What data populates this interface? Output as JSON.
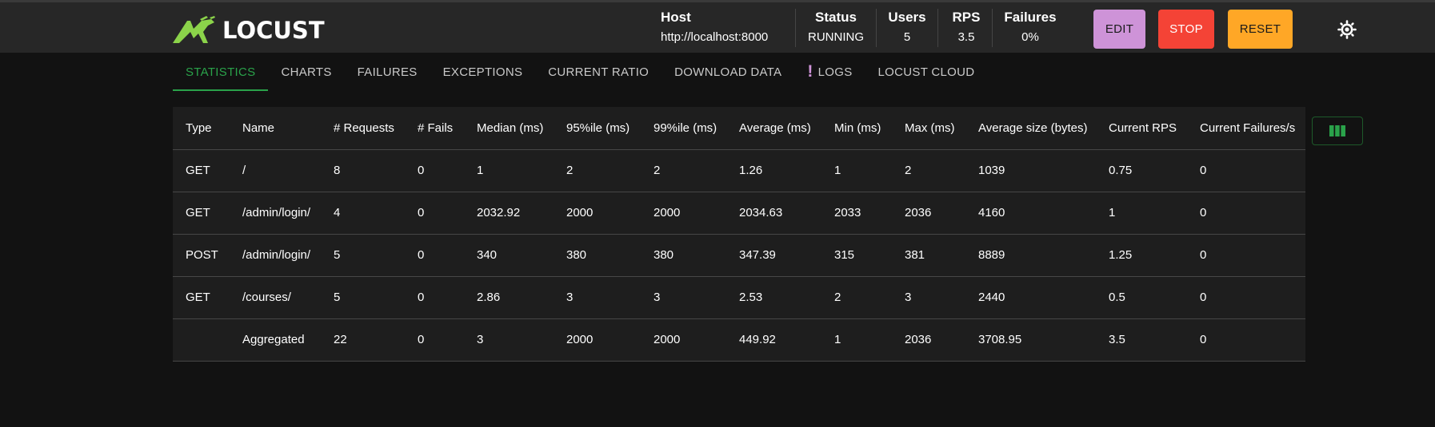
{
  "app": {
    "name": "LOCUST",
    "brand_color": "#8bd34a"
  },
  "header": {
    "host": {
      "label": "Host",
      "value": "http://localhost:8000"
    },
    "status": {
      "label": "Status",
      "value": "RUNNING"
    },
    "users": {
      "label": "Users",
      "value": "5"
    },
    "rps": {
      "label": "RPS",
      "value": "3.5"
    },
    "failures": {
      "label": "Failures",
      "value": "0%"
    },
    "buttons": {
      "edit": "EDIT",
      "stop": "STOP",
      "reset": "RESET"
    },
    "theme_icon": "sun-icon"
  },
  "tabs": [
    {
      "label": "STATISTICS",
      "active": true
    },
    {
      "label": "CHARTS"
    },
    {
      "label": "FAILURES"
    },
    {
      "label": "EXCEPTIONS"
    },
    {
      "label": "CURRENT RATIO"
    },
    {
      "label": "DOWNLOAD DATA"
    },
    {
      "label": "LOGS",
      "icon": "exclamation-icon"
    },
    {
      "label": "LOCUST CLOUD"
    }
  ],
  "table": {
    "columns": [
      "Type",
      "Name",
      "# Requests",
      "# Fails",
      "Median (ms)",
      "95%ile (ms)",
      "99%ile (ms)",
      "Average (ms)",
      "Min (ms)",
      "Max (ms)",
      "Average size (bytes)",
      "Current RPS",
      "Current Failures/s"
    ],
    "rows": [
      [
        "GET",
        "/",
        "8",
        "0",
        "1",
        "2",
        "2",
        "1.26",
        "1",
        "2",
        "1039",
        "0.75",
        "0"
      ],
      [
        "GET",
        "/admin/login/",
        "4",
        "0",
        "2032.92",
        "2000",
        "2000",
        "2034.63",
        "2033",
        "2036",
        "4160",
        "1",
        "0"
      ],
      [
        "POST",
        "/admin/login/",
        "5",
        "0",
        "340",
        "380",
        "380",
        "347.39",
        "315",
        "381",
        "8889",
        "1.25",
        "0"
      ],
      [
        "GET",
        "/courses/",
        "5",
        "0",
        "2.86",
        "3",
        "3",
        "2.53",
        "2",
        "3",
        "2440",
        "0.5",
        "0"
      ],
      [
        "",
        "Aggregated",
        "22",
        "0",
        "3",
        "2000",
        "2000",
        "449.92",
        "1",
        "2036",
        "3708.95",
        "3.5",
        "0"
      ]
    ],
    "column_selector_icon": "columns-icon"
  },
  "colors": {
    "accent": "#2aa24a",
    "edit": "#ce93d8",
    "stop": "#f44336",
    "reset": "#ffa726"
  }
}
